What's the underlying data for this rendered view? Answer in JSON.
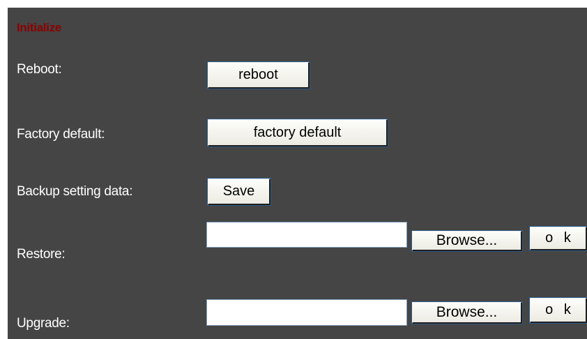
{
  "section": {
    "title": "Initialize"
  },
  "reboot": {
    "label": "Reboot:",
    "button": "reboot"
  },
  "factory_default": {
    "label": "Factory default:",
    "button": "factory default"
  },
  "backup": {
    "label": "Backup setting data:",
    "button": "Save"
  },
  "restore": {
    "label": "Restore:",
    "file_value": "",
    "browse_button": "Browse...",
    "ok_button": "o k"
  },
  "upgrade": {
    "label": "Upgrade:",
    "file_value": "",
    "browse_button": "Browse...",
    "ok_button": "o k"
  }
}
